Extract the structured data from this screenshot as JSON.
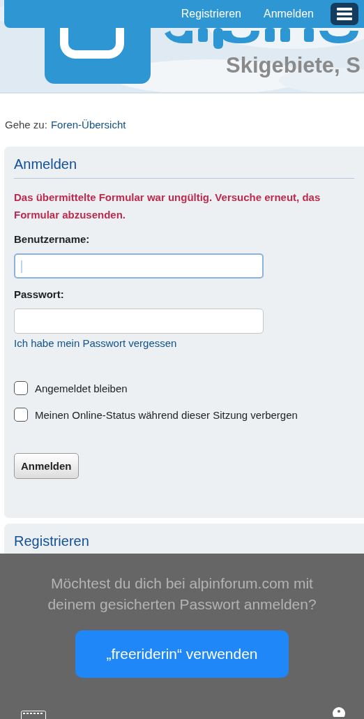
{
  "nav": {
    "links": [
      "Registrieren",
      "Anmelden"
    ]
  },
  "logo": {
    "tagline": "Skigebiete, S"
  },
  "breadcrumb": {
    "prefix": "Gehe zu:",
    "link": "Foren-Übersicht"
  },
  "login": {
    "title": "Anmelden",
    "error": "Das übermittelte Formular war ungültig. Versuche erneut, das Formular abzusenden.",
    "fields": [
      {
        "label": "Benutzername:",
        "focused": true
      },
      {
        "label": "Passwort:",
        "focused": false
      }
    ],
    "forgot": "Ich habe mein Passwort vergessen",
    "options": [
      {
        "label": "Angemeldet bleiben",
        "checked": false
      },
      {
        "label": "Meinen Online-Status während dieser Sitzung verbergen",
        "checked": false
      }
    ],
    "submit": "Anmelden"
  },
  "register": {
    "title": "Registrieren"
  },
  "prompt": {
    "message": "Möchtest du dich bei alpinforum.com mit deinem gesicherten Passwort anmelden?",
    "button": "„freeriderin“ verwenden"
  }
}
